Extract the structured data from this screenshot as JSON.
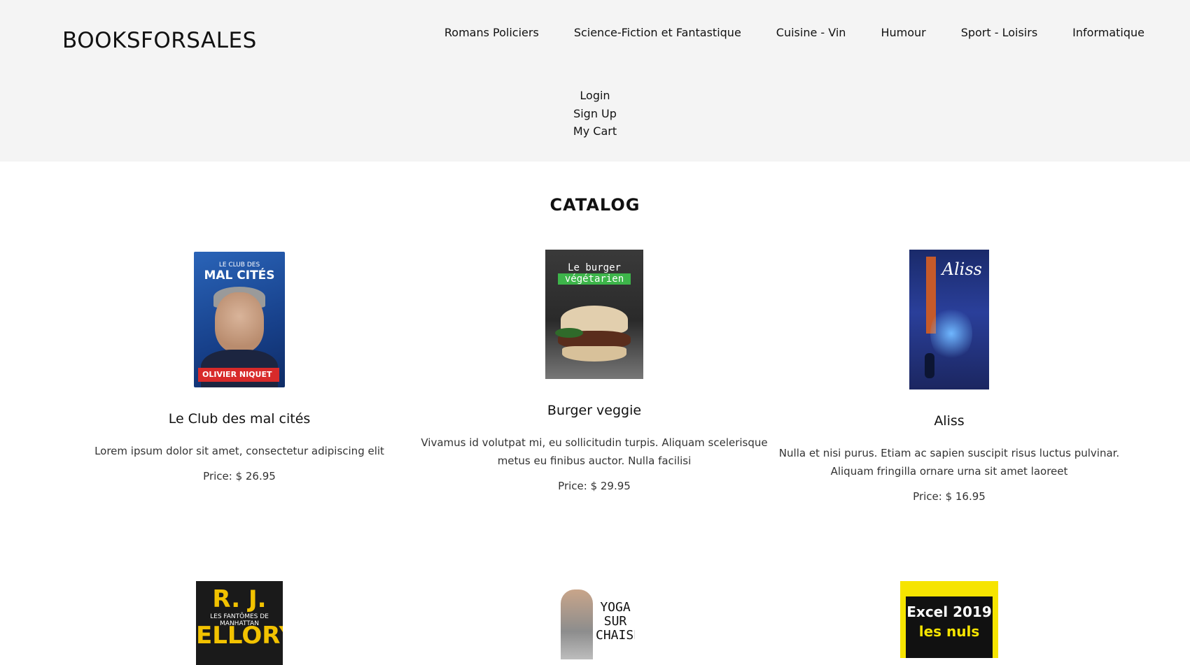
{
  "header": {
    "logo": "BOOKSFORSALES",
    "nav": [
      "Romans Policiers",
      "Science-Fiction et Fantastique",
      "Cuisine - Vin",
      "Humour",
      "Sport - Loisirs",
      "Informatique"
    ],
    "account_links": [
      "Login",
      "Sign Up",
      "My Cart"
    ]
  },
  "catalog": {
    "title": "CATALOG",
    "products": [
      {
        "title": "Le Club des mal cités",
        "description": "Lorem ipsum dolor sit amet, consectetur adipiscing elit",
        "price": "Price: $ 26.95",
        "cover_text": [
          "LE CLUB DES",
          "MAL CITÉS",
          "OLIVIER NIQUET"
        ]
      },
      {
        "title": "Burger veggie",
        "description": "Vivamus id volutpat mi, eu sollicitudin turpis. Aliquam scelerisque metus eu finibus auctor. Nulla facilisi",
        "price": "Price: $ 29.95",
        "cover_text": [
          "Le burger",
          "végétarien"
        ]
      },
      {
        "title": "Aliss",
        "description": "Nulla et nisi purus. Etiam ac sapien suscipit risus luctus pulvinar. Aliquam fringilla ornare urna sit amet laoreet",
        "price": "Price: $ 16.95",
        "cover_text": [
          "Aliss"
        ]
      },
      {
        "title": "",
        "description": "",
        "price": "",
        "cover_text": [
          "R. J.",
          "LES FANTÔMES DE MANHATTAN",
          "ELLORY"
        ]
      },
      {
        "title": "",
        "description": "",
        "price": "",
        "cover_text": [
          "YOGA SUR CHAISE"
        ]
      },
      {
        "title": "",
        "description": "",
        "price": "",
        "cover_text": [
          "Excel 2019",
          "les nuls"
        ]
      }
    ]
  }
}
